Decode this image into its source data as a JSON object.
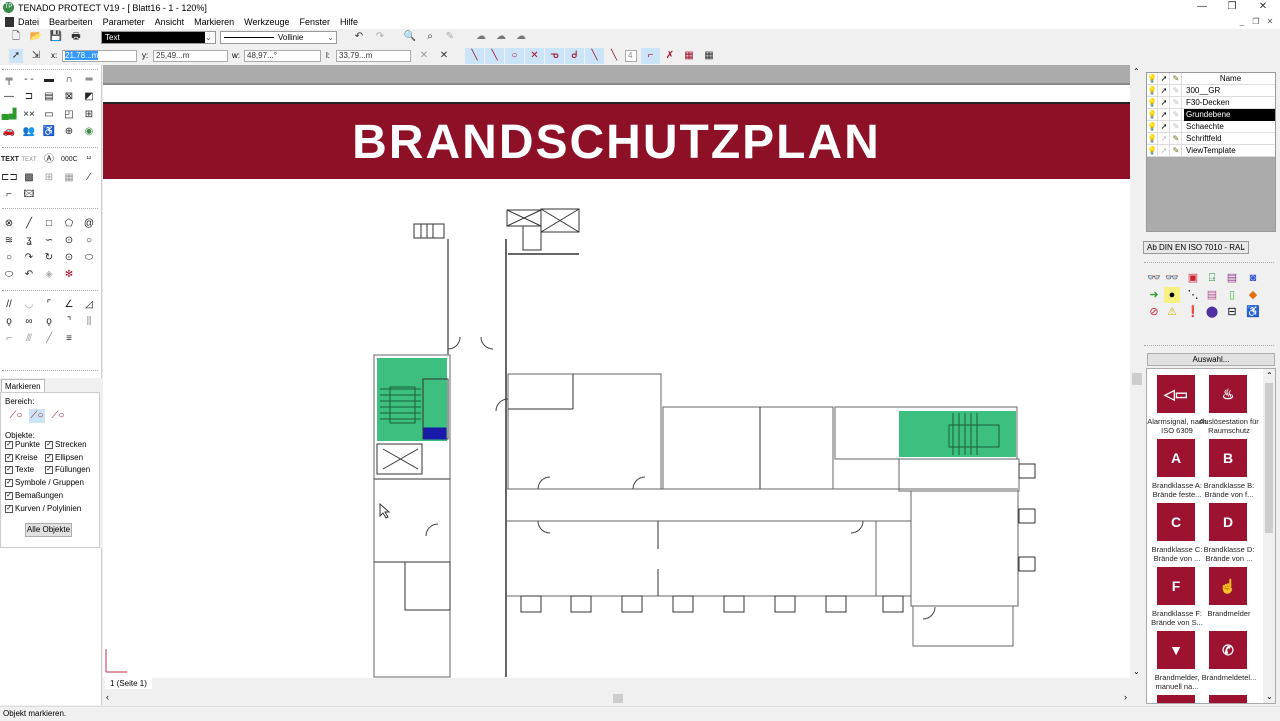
{
  "window": {
    "title": "TENADO PROTECT V19 - [ Blatt16 - 1 - 120%]",
    "logo": "TP",
    "minimize": "—",
    "restore": "❐",
    "close": "✕"
  },
  "menu": [
    "Datei",
    "Bearbeiten",
    "Parameter",
    "Ansicht",
    "Markieren",
    "Werkzeuge",
    "Fenster",
    "Hilfe"
  ],
  "toolbar": {
    "layer_combo": "Text",
    "linetype_combo": "Vollinie",
    "undo": "↶",
    "redo": "↷"
  },
  "coords": {
    "x_label": "x:",
    "x_value": "21,78...m",
    "y_label": "y:",
    "y_value": "25,49...m",
    "w_label": "w:",
    "w_value": "48,97...°",
    "l_label": "l:",
    "l_value": "33,79...m",
    "snap_value": "4"
  },
  "mark_panel": {
    "tab": "Markieren",
    "bereich_label": "Bereich:",
    "objekte_label": "Objekte:",
    "checkboxes": [
      {
        "label": "Punkte",
        "checked": true
      },
      {
        "label": "Strecken",
        "checked": true
      },
      {
        "label": "Kreise",
        "checked": true
      },
      {
        "label": "Ellipsen",
        "checked": true
      },
      {
        "label": "Texte",
        "checked": true
      },
      {
        "label": "Füllungen",
        "checked": true
      },
      {
        "label": "Symbole / Gruppen",
        "checked": true
      },
      {
        "label": "Bemaßungen",
        "checked": true
      },
      {
        "label": "Kurven / Polylinien",
        "checked": true
      }
    ],
    "all_button": "Alle Objekte"
  },
  "drawing": {
    "banner_title": "BRANDSCHUTZPLAN",
    "page_tab": "1 (Seite 1)",
    "accent": "#8e1027",
    "stair_fill": "#3dbf7f"
  },
  "layers": {
    "header": "Name",
    "rows": [
      {
        "name": "300__GR",
        "selected": false
      },
      {
        "name": "F30-Decken",
        "selected": false
      },
      {
        "name": "Grundebene",
        "selected": true
      },
      {
        "name": "Schaechte",
        "selected": false
      },
      {
        "name": "Schriftfeld",
        "selected": false
      },
      {
        "name": "ViewTemplate",
        "selected": false
      }
    ]
  },
  "symbol_library": {
    "standard": "Ab DIN EN ISO 7010 - RAL",
    "select_button": "Auswahl...",
    "signs": [
      {
        "name": "Alarmsignal, nach ISO 6309",
        "glyph": "◁▭"
      },
      {
        "name": "Auslösestation für Raumschutz",
        "glyph": "♨"
      },
      {
        "name": "Brandklasse A: Brände feste...",
        "glyph": "A"
      },
      {
        "name": "Brandklasse B: Brände von f...",
        "glyph": "B"
      },
      {
        "name": "Brandklasse C: Brände von ...",
        "glyph": "C"
      },
      {
        "name": "Brandklasse D: Brände von ...",
        "glyph": "D"
      },
      {
        "name": "Brandklasse F: Brände von S...",
        "glyph": "F"
      },
      {
        "name": "Brandmelder",
        "glyph": "☝"
      },
      {
        "name": "Brandmelder, manuell na...",
        "glyph": "▼"
      },
      {
        "name": "Brandmeldetel...",
        "glyph": "✆"
      }
    ]
  },
  "status": "Objekt markieren."
}
